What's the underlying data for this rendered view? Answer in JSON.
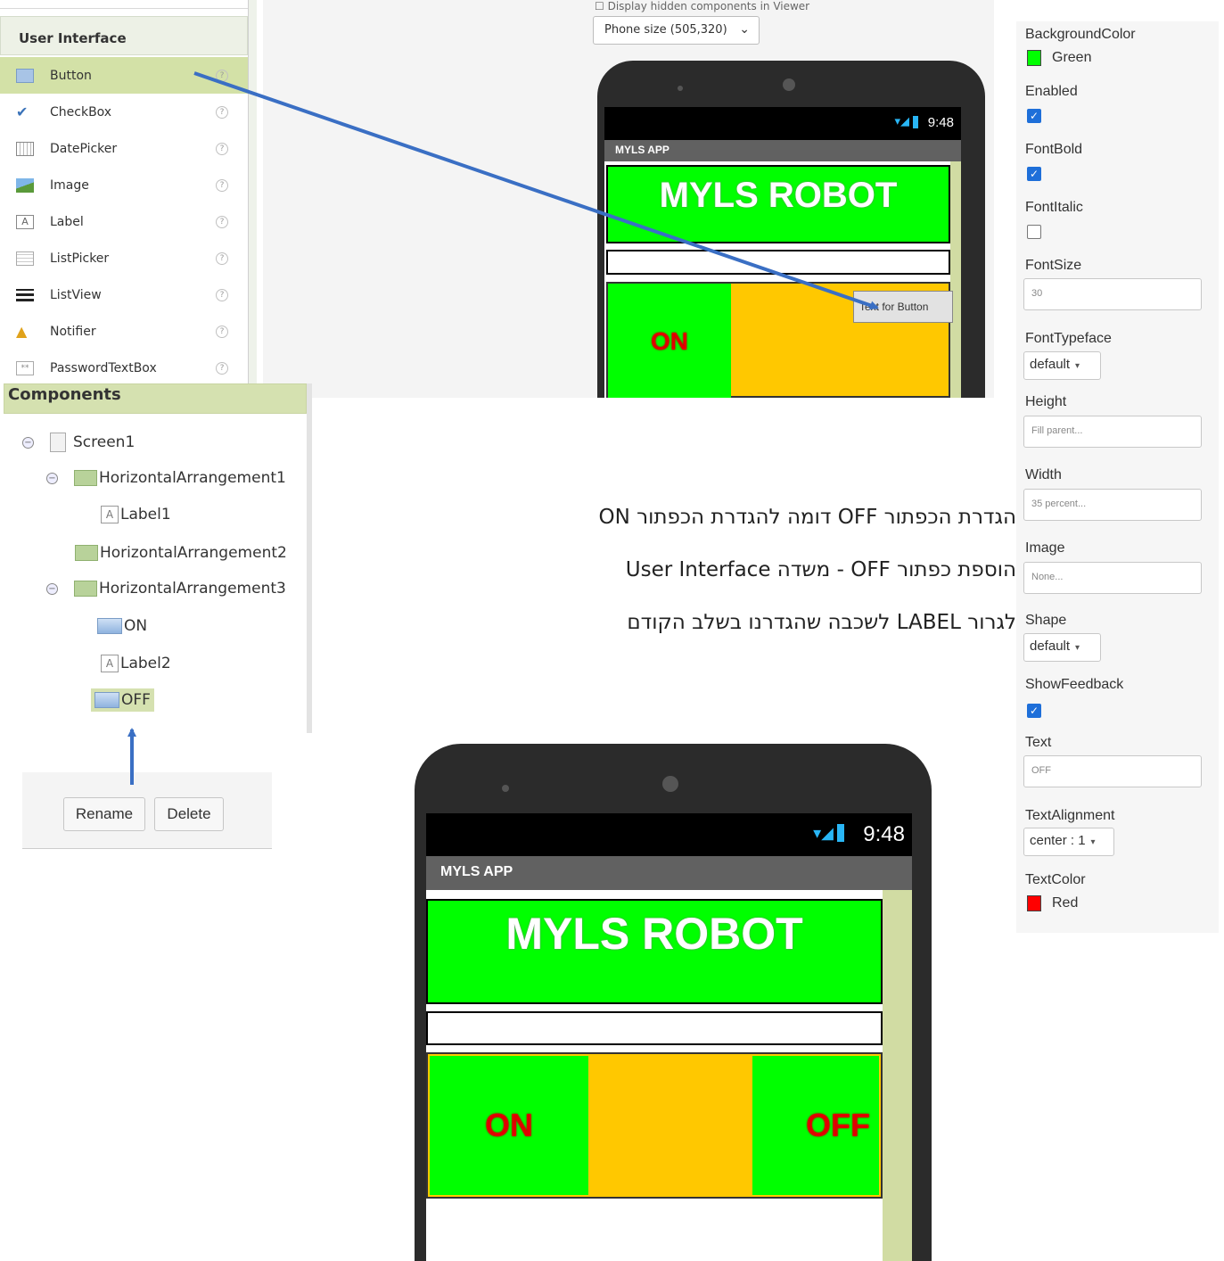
{
  "palette": {
    "header": "User Interface",
    "items": [
      {
        "label": "Button",
        "icon": "button-icon",
        "selected": true
      },
      {
        "label": "CheckBox",
        "icon": "checkbox-icon"
      },
      {
        "label": "DatePicker",
        "icon": "datepicker-icon"
      },
      {
        "label": "Image",
        "icon": "image-icon"
      },
      {
        "label": "Label",
        "icon": "label-icon"
      },
      {
        "label": "ListPicker",
        "icon": "listpicker-icon"
      },
      {
        "label": "ListView",
        "icon": "listview-icon"
      },
      {
        "label": "Notifier",
        "icon": "notifier-icon"
      },
      {
        "label": "PasswordTextBox",
        "icon": "passwordtextbox-icon"
      }
    ],
    "help_glyph": "?"
  },
  "viewer": {
    "hidden_components_label": "Display hidden components in Viewer",
    "phone_size": "Phone size (505,320)",
    "phone_top": {
      "time": "9:48",
      "app_title": "MYLS APP",
      "title_text": "MYLS ROBOT",
      "on_label": "ON",
      "dragged_button": "Text for Button"
    }
  },
  "components": {
    "header": "Components",
    "nodes": [
      {
        "label": "Screen1"
      },
      {
        "label": "HorizontalArrangement1"
      },
      {
        "label": "Label1"
      },
      {
        "label": "HorizontalArrangement2"
      },
      {
        "label": "HorizontalArrangement3"
      },
      {
        "label": "ON"
      },
      {
        "label": "Label2"
      },
      {
        "label": "OFF",
        "selected": true
      }
    ],
    "collapse_glyph": "−"
  },
  "actions": {
    "rename": "Rename",
    "delete": "Delete"
  },
  "instructions": {
    "line1": "הגדרת הכפתור  OFF דומה להגדרת הכפתור  ON",
    "line2": "הוספת כפתור  OFF - משדה  User Interface",
    "line3": "לגרור LABEL לשכבה שהגדרנו בשלב הקודם"
  },
  "properties": {
    "background_color_label": "BackgroundColor",
    "background_color_value": "Green",
    "background_color_hex": "#00ff00",
    "enabled_label": "Enabled",
    "enabled": true,
    "font_bold_label": "FontBold",
    "font_bold": true,
    "font_italic_label": "FontItalic",
    "font_italic": false,
    "font_size_label": "FontSize",
    "font_size_value": "30",
    "font_typeface_label": "FontTypeface",
    "font_typeface_value": "default",
    "height_label": "Height",
    "height_value": "Fill parent...",
    "width_label": "Width",
    "width_value": "35 percent...",
    "image_label": "Image",
    "image_value": "None...",
    "shape_label": "Shape",
    "shape_value": "default",
    "show_feedback_label": "ShowFeedback",
    "show_feedback": true,
    "text_label": "Text",
    "text_value": "OFF",
    "text_alignment_label": "TextAlignment",
    "text_alignment_value": "center : 1",
    "text_color_label": "TextColor",
    "text_color_value": "Red",
    "text_color_hex": "#ff0000",
    "check_glyph": "✓",
    "dropdown_glyph": "▾"
  },
  "phone_bottom": {
    "time": "9:48",
    "app_title": "MYLS APP",
    "title_text": "MYLS ROBOT",
    "on_label": "ON",
    "off_label": "OFF"
  },
  "colors": {
    "accent_green": "#00ff00",
    "arrangement_orange": "#ffc800",
    "button_text_red": "#e00000",
    "selection_green": "#d3e1a7",
    "arrow_blue": "#3a6fc4"
  }
}
